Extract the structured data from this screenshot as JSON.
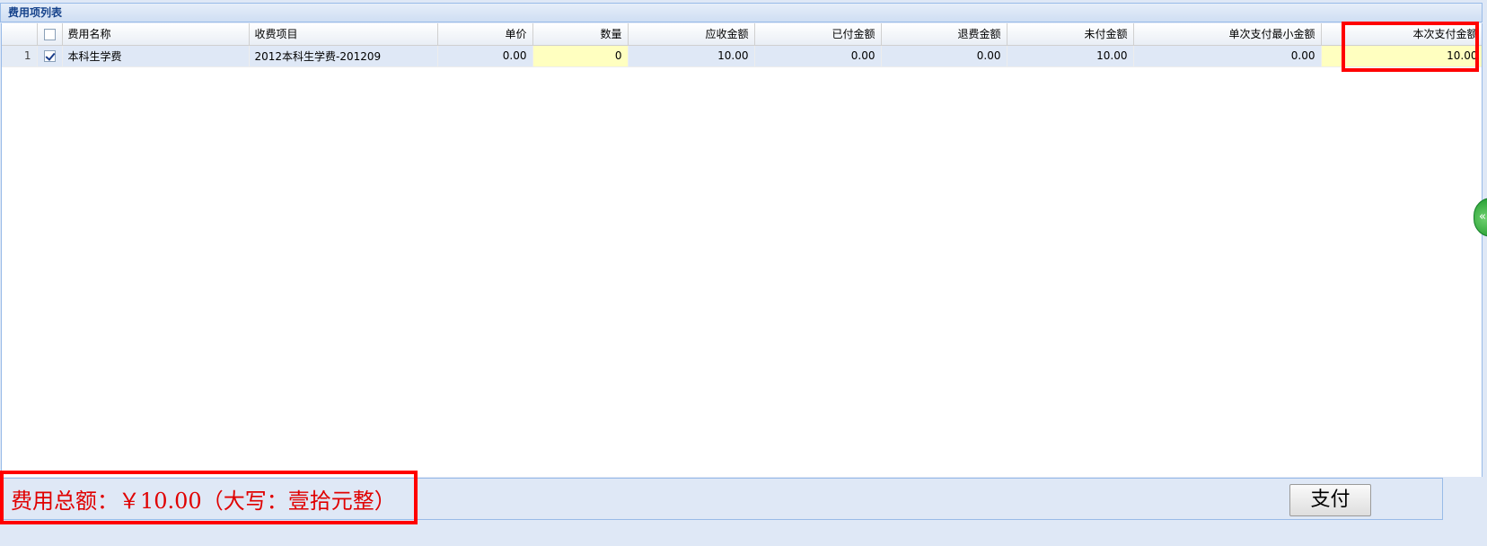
{
  "panel": {
    "title": "费用项列表"
  },
  "grid": {
    "columns": [
      "",
      "",
      "费用名称",
      "收费项目",
      "单价",
      "数量",
      "应收金额",
      "已付金额",
      "退费金额",
      "未付金额",
      "单次支付最小金额",
      "本次支付金额"
    ],
    "header_checkbox_checked": false,
    "rows": [
      {
        "rownum": "1",
        "checked": true,
        "name": "本科生学费",
        "item": "2012本科生学费-201209",
        "unit_price": "0.00",
        "quantity": "0",
        "receivable": "10.00",
        "paid": "0.00",
        "refund": "0.00",
        "unpaid": "10.00",
        "min_payment": "0.00",
        "this_payment": "10.00"
      }
    ]
  },
  "footer": {
    "total_text": "费用总额：￥10.00（大写：壹拾元整）",
    "pay_button": "支付"
  },
  "side_handle": {
    "glyph": "«"
  },
  "colors": {
    "highlight_border": "#ff0000",
    "total_text": "#e00000",
    "editable_cell": "#ffffc0",
    "header_text": "#15428b"
  }
}
